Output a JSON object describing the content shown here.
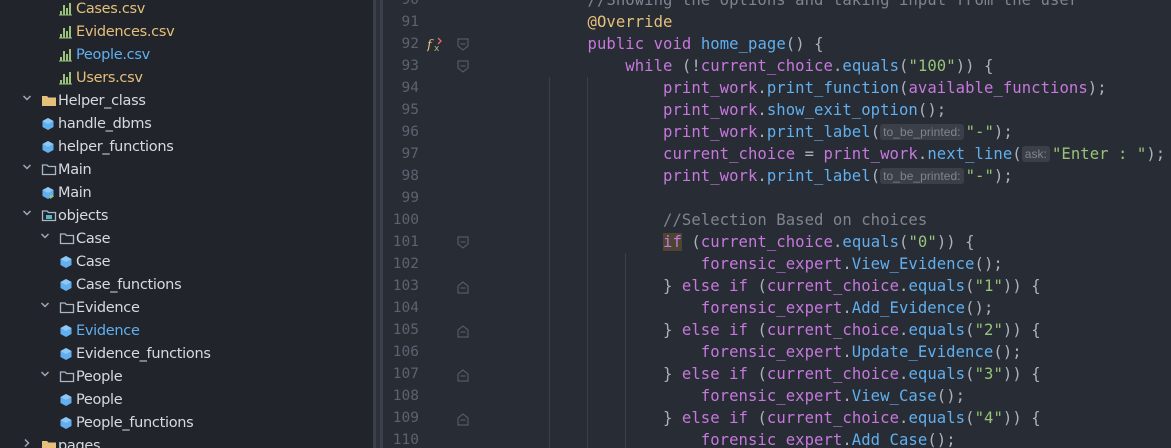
{
  "sidebar": {
    "items": [
      {
        "label": "Cases.csv",
        "type": "csv",
        "chev": "",
        "level": 3,
        "color": "#e5c07b"
      },
      {
        "label": "Evidences.csv",
        "type": "csv",
        "chev": "",
        "level": 3,
        "color": "#e5c07b"
      },
      {
        "label": "People.csv",
        "type": "csv",
        "chev": "",
        "level": 3,
        "color": "#61afef"
      },
      {
        "label": "Users.csv",
        "type": "csv",
        "chev": "",
        "level": 3,
        "color": "#e5c07b"
      },
      {
        "label": "Helper_class",
        "type": "folder-filled",
        "chev": "open",
        "level": 1,
        "color": "#d7dae0"
      },
      {
        "label": "handle_dbms",
        "type": "class",
        "chev": "",
        "level": 2,
        "color": "#d7dae0"
      },
      {
        "label": "helper_functions",
        "type": "class",
        "chev": "",
        "level": 2,
        "color": "#d7dae0"
      },
      {
        "label": "Main",
        "type": "folder",
        "chev": "open",
        "level": 1,
        "color": "#d7dae0"
      },
      {
        "label": "Main",
        "type": "class-main",
        "chev": "",
        "level": 2,
        "color": "#d7dae0"
      },
      {
        "label": "objects",
        "type": "module",
        "chev": "open",
        "level": 1,
        "color": "#d7dae0"
      },
      {
        "label": "Case",
        "type": "folder",
        "chev": "open",
        "level": 2,
        "color": "#d7dae0"
      },
      {
        "label": "Case",
        "type": "class",
        "chev": "",
        "level": 3,
        "color": "#d7dae0"
      },
      {
        "label": "Case_functions",
        "type": "class",
        "chev": "",
        "level": 3,
        "color": "#d7dae0"
      },
      {
        "label": "Evidence",
        "type": "folder",
        "chev": "open",
        "level": 2,
        "color": "#d7dae0"
      },
      {
        "label": "Evidence",
        "type": "class",
        "chev": "",
        "level": 3,
        "color": "#61afef"
      },
      {
        "label": "Evidence_functions",
        "type": "class",
        "chev": "",
        "level": 3,
        "color": "#d7dae0"
      },
      {
        "label": "People",
        "type": "folder",
        "chev": "open",
        "level": 2,
        "color": "#d7dae0"
      },
      {
        "label": "People",
        "type": "class",
        "chev": "",
        "level": 3,
        "color": "#d7dae0"
      },
      {
        "label": "People_functions",
        "type": "class",
        "chev": "",
        "level": 3,
        "color": "#d7dae0"
      },
      {
        "label": "pages",
        "type": "folder-filled",
        "chev": "closed",
        "level": 1,
        "color": "#d7dae0"
      }
    ]
  },
  "editor": {
    "lines": [
      {
        "num": "90",
        "tokens": [
          {
            "t": "        ",
            "c": ""
          },
          {
            "t": "//Showing the options and taking input from the user",
            "c": "cm"
          }
        ]
      },
      {
        "num": "91",
        "tokens": [
          {
            "t": "        ",
            "c": ""
          },
          {
            "t": "@Override",
            "c": "ann"
          }
        ]
      },
      {
        "num": "92",
        "tokens": [
          {
            "t": "        ",
            "c": ""
          },
          {
            "t": "public",
            "c": "kw"
          },
          {
            "t": " ",
            "c": ""
          },
          {
            "t": "void",
            "c": "kw"
          },
          {
            "t": " ",
            "c": ""
          },
          {
            "t": "home_page",
            "c": "fn"
          },
          {
            "t": "() {",
            "c": ""
          }
        ]
      },
      {
        "num": "93",
        "tokens": [
          {
            "t": "            ",
            "c": ""
          },
          {
            "t": "while",
            "c": "kw"
          },
          {
            "t": " (!",
            "c": ""
          },
          {
            "t": "current_choice",
            "c": "fld"
          },
          {
            "t": ".",
            "c": ""
          },
          {
            "t": "equals",
            "c": "fn"
          },
          {
            "t": "(",
            "c": ""
          },
          {
            "t": "\"100\"",
            "c": "str"
          },
          {
            "t": ")) {",
            "c": ""
          }
        ]
      },
      {
        "num": "94",
        "tokens": [
          {
            "t": "                ",
            "c": ""
          },
          {
            "t": "print_work",
            "c": "obj"
          },
          {
            "t": ".",
            "c": ""
          },
          {
            "t": "print_function",
            "c": "fn"
          },
          {
            "t": "(",
            "c": ""
          },
          {
            "t": "available_functions",
            "c": "obj"
          },
          {
            "t": ");",
            "c": ""
          }
        ]
      },
      {
        "num": "95",
        "tokens": [
          {
            "t": "                ",
            "c": ""
          },
          {
            "t": "print_work",
            "c": "obj"
          },
          {
            "t": ".",
            "c": ""
          },
          {
            "t": "show_exit_option",
            "c": "fn"
          },
          {
            "t": "();",
            "c": ""
          }
        ]
      },
      {
        "num": "96",
        "tokens": [
          {
            "t": "                ",
            "c": ""
          },
          {
            "t": "print_work",
            "c": "obj"
          },
          {
            "t": ".",
            "c": ""
          },
          {
            "t": "print_label",
            "c": "fn"
          },
          {
            "t": "(",
            "c": ""
          },
          {
            "t": "to_be_printed:",
            "c": "hint"
          },
          {
            "t": "\"-\"",
            "c": "str"
          },
          {
            "t": ");",
            "c": ""
          }
        ]
      },
      {
        "num": "97",
        "tokens": [
          {
            "t": "                ",
            "c": ""
          },
          {
            "t": "current_choice",
            "c": "obj"
          },
          {
            "t": " = ",
            "c": ""
          },
          {
            "t": "print_work",
            "c": "obj"
          },
          {
            "t": ".",
            "c": ""
          },
          {
            "t": "next_line",
            "c": "fn"
          },
          {
            "t": "(",
            "c": ""
          },
          {
            "t": "ask:",
            "c": "hint"
          },
          {
            "t": "\"Enter : \"",
            "c": "str"
          },
          {
            "t": ");",
            "c": ""
          }
        ]
      },
      {
        "num": "98",
        "tokens": [
          {
            "t": "                ",
            "c": ""
          },
          {
            "t": "print_work",
            "c": "obj"
          },
          {
            "t": ".",
            "c": ""
          },
          {
            "t": "print_label",
            "c": "fn"
          },
          {
            "t": "(",
            "c": ""
          },
          {
            "t": "to_be_printed:",
            "c": "hint"
          },
          {
            "t": "\"-\"",
            "c": "str"
          },
          {
            "t": ");",
            "c": ""
          }
        ]
      },
      {
        "num": "99",
        "tokens": []
      },
      {
        "num": "100",
        "tokens": [
          {
            "t": "                ",
            "c": ""
          },
          {
            "t": "//Selection Based on choices",
            "c": "cm"
          }
        ]
      },
      {
        "num": "101",
        "tokens": [
          {
            "t": "                ",
            "c": ""
          },
          {
            "t": "if",
            "c": "kwhl"
          },
          {
            "t": " (",
            "c": ""
          },
          {
            "t": "current_choice",
            "c": "obj"
          },
          {
            "t": ".",
            "c": ""
          },
          {
            "t": "equals",
            "c": "fn"
          },
          {
            "t": "(",
            "c": ""
          },
          {
            "t": "\"0\"",
            "c": "str"
          },
          {
            "t": ")) {",
            "c": ""
          }
        ]
      },
      {
        "num": "102",
        "tokens": [
          {
            "t": "                    ",
            "c": ""
          },
          {
            "t": "forensic_expert",
            "c": "obj"
          },
          {
            "t": ".",
            "c": ""
          },
          {
            "t": "View_Evidence",
            "c": "fn"
          },
          {
            "t": "();",
            "c": ""
          }
        ]
      },
      {
        "num": "103",
        "tokens": [
          {
            "t": "                } ",
            "c": ""
          },
          {
            "t": "else",
            "c": "kw"
          },
          {
            "t": " ",
            "c": ""
          },
          {
            "t": "if",
            "c": "kw"
          },
          {
            "t": " (",
            "c": ""
          },
          {
            "t": "current_choice",
            "c": "obj"
          },
          {
            "t": ".",
            "c": ""
          },
          {
            "t": "equals",
            "c": "fn"
          },
          {
            "t": "(",
            "c": ""
          },
          {
            "t": "\"1\"",
            "c": "str"
          },
          {
            "t": ")) {",
            "c": ""
          }
        ]
      },
      {
        "num": "104",
        "tokens": [
          {
            "t": "                    ",
            "c": ""
          },
          {
            "t": "forensic_expert",
            "c": "obj"
          },
          {
            "t": ".",
            "c": ""
          },
          {
            "t": "Add_Evidence",
            "c": "fn"
          },
          {
            "t": "();",
            "c": ""
          }
        ]
      },
      {
        "num": "105",
        "tokens": [
          {
            "t": "                } ",
            "c": ""
          },
          {
            "t": "else",
            "c": "kw"
          },
          {
            "t": " ",
            "c": ""
          },
          {
            "t": "if",
            "c": "kw"
          },
          {
            "t": " (",
            "c": ""
          },
          {
            "t": "current_choice",
            "c": "obj"
          },
          {
            "t": ".",
            "c": ""
          },
          {
            "t": "equals",
            "c": "fn"
          },
          {
            "t": "(",
            "c": ""
          },
          {
            "t": "\"2\"",
            "c": "str"
          },
          {
            "t": ")) {",
            "c": ""
          }
        ]
      },
      {
        "num": "106",
        "tokens": [
          {
            "t": "                    ",
            "c": ""
          },
          {
            "t": "forensic_expert",
            "c": "obj"
          },
          {
            "t": ".",
            "c": ""
          },
          {
            "t": "Update_Evidence",
            "c": "fn"
          },
          {
            "t": "();",
            "c": ""
          }
        ]
      },
      {
        "num": "107",
        "tokens": [
          {
            "t": "                } ",
            "c": ""
          },
          {
            "t": "else",
            "c": "kw"
          },
          {
            "t": " ",
            "c": ""
          },
          {
            "t": "if",
            "c": "kw"
          },
          {
            "t": " (",
            "c": ""
          },
          {
            "t": "current_choice",
            "c": "obj"
          },
          {
            "t": ".",
            "c": ""
          },
          {
            "t": "equals",
            "c": "fn"
          },
          {
            "t": "(",
            "c": ""
          },
          {
            "t": "\"3\"",
            "c": "str"
          },
          {
            "t": ")) {",
            "c": ""
          }
        ]
      },
      {
        "num": "108",
        "tokens": [
          {
            "t": "                    ",
            "c": ""
          },
          {
            "t": "forensic_expert",
            "c": "obj"
          },
          {
            "t": ".",
            "c": ""
          },
          {
            "t": "View_Case",
            "c": "fn"
          },
          {
            "t": "();",
            "c": ""
          }
        ]
      },
      {
        "num": "109",
        "tokens": [
          {
            "t": "                } ",
            "c": ""
          },
          {
            "t": "else",
            "c": "kw"
          },
          {
            "t": " ",
            "c": ""
          },
          {
            "t": "if",
            "c": "kw"
          },
          {
            "t": " (",
            "c": ""
          },
          {
            "t": "current_choice",
            "c": "obj"
          },
          {
            "t": ".",
            "c": ""
          },
          {
            "t": "equals",
            "c": "fn"
          },
          {
            "t": "(",
            "c": ""
          },
          {
            "t": "\"4\"",
            "c": "str"
          },
          {
            "t": ")) {",
            "c": ""
          }
        ]
      },
      {
        "num": "110",
        "tokens": [
          {
            "t": "                    ",
            "c": ""
          },
          {
            "t": "forensic_expert",
            "c": "obj"
          },
          {
            "t": ".",
            "c": ""
          },
          {
            "t": "Add_Case",
            "c": "fn"
          },
          {
            "t": "();",
            "c": ""
          }
        ]
      }
    ]
  },
  "colors": {
    "sidebar_bg": "#21252b",
    "editor_bg": "#282c34",
    "selected_file": "#61afef",
    "csv_icon": "#98c379",
    "folder_icon": "#e5c07b",
    "class_icon": "#61afef",
    "module_icon": "#56b6c2"
  }
}
